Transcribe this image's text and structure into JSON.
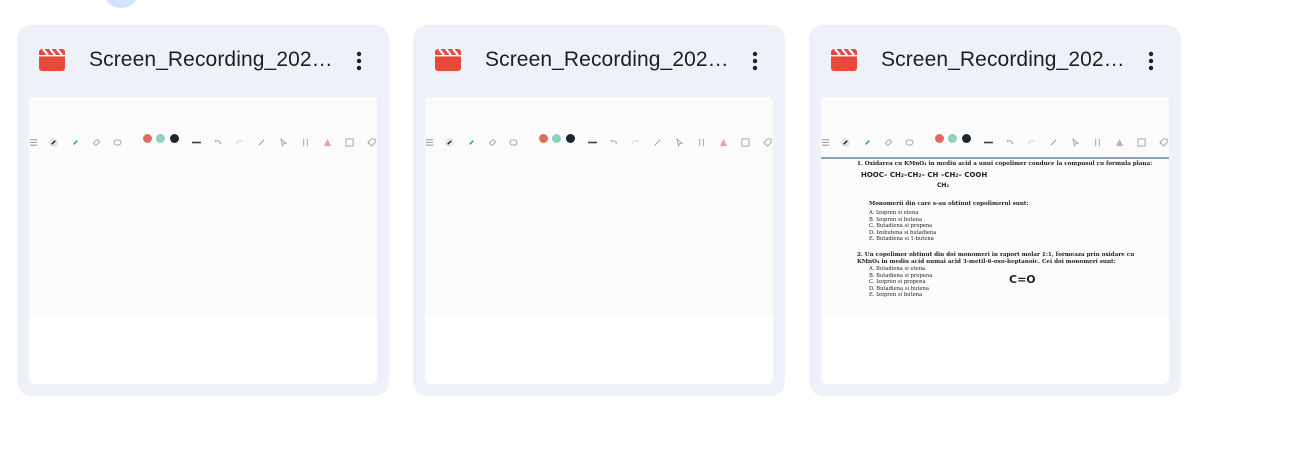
{
  "cards": [
    {
      "name": "Screen_Recording_2025-...",
      "has_document": false
    },
    {
      "name": "Screen_Recording_2025-...",
      "has_document": false
    },
    {
      "name": "Screen_Recording_2025-...",
      "has_document": true
    }
  ],
  "icons": {
    "file": "video-file-icon",
    "more": "more-vert-icon"
  },
  "colors": {
    "card_bg": "#eef2f8",
    "file_icon": "#e9493b",
    "swatch_red": "#e06c5f",
    "swatch_teal": "#8fd1bf",
    "swatch_dark": "#1d2530",
    "marker_green": "#3aa86b"
  },
  "document": {
    "q1": "1.  Oxidarea cu KMnO₄ in mediu acid a unui copolimer conduce la compusul cu formula plana:",
    "formula": "HOOC– CH₂–CH₂– CH –CH₂– COOH",
    "formula_sub": "CH₃",
    "q1_sub": "Monomerii din care s-au obtinut copolimerul sunt:",
    "q1_options": [
      "A.  Izopren si etena",
      "B.  Izopren si butena",
      "C.  Butadiena si propena",
      "D.  Izobutena si butadiena",
      "E.  Butadiena si 1-butena"
    ],
    "q2": "2.  Un copolimer obtinut din doi monomeri in raport molar 1:1, formeaza prin oxidare cu KMnO₄ in mediu acid numai acid 3-metil-6-oxo-heptanoic. Cei doi monomeri sunt:",
    "q2_options": [
      "A.  Butadiena si etena",
      "B.  Butadiena si propena",
      "C.  Izopren si propena",
      "D.  Butadiena si butena",
      "E.  Izopren si butena"
    ],
    "annotation": "C=O"
  }
}
